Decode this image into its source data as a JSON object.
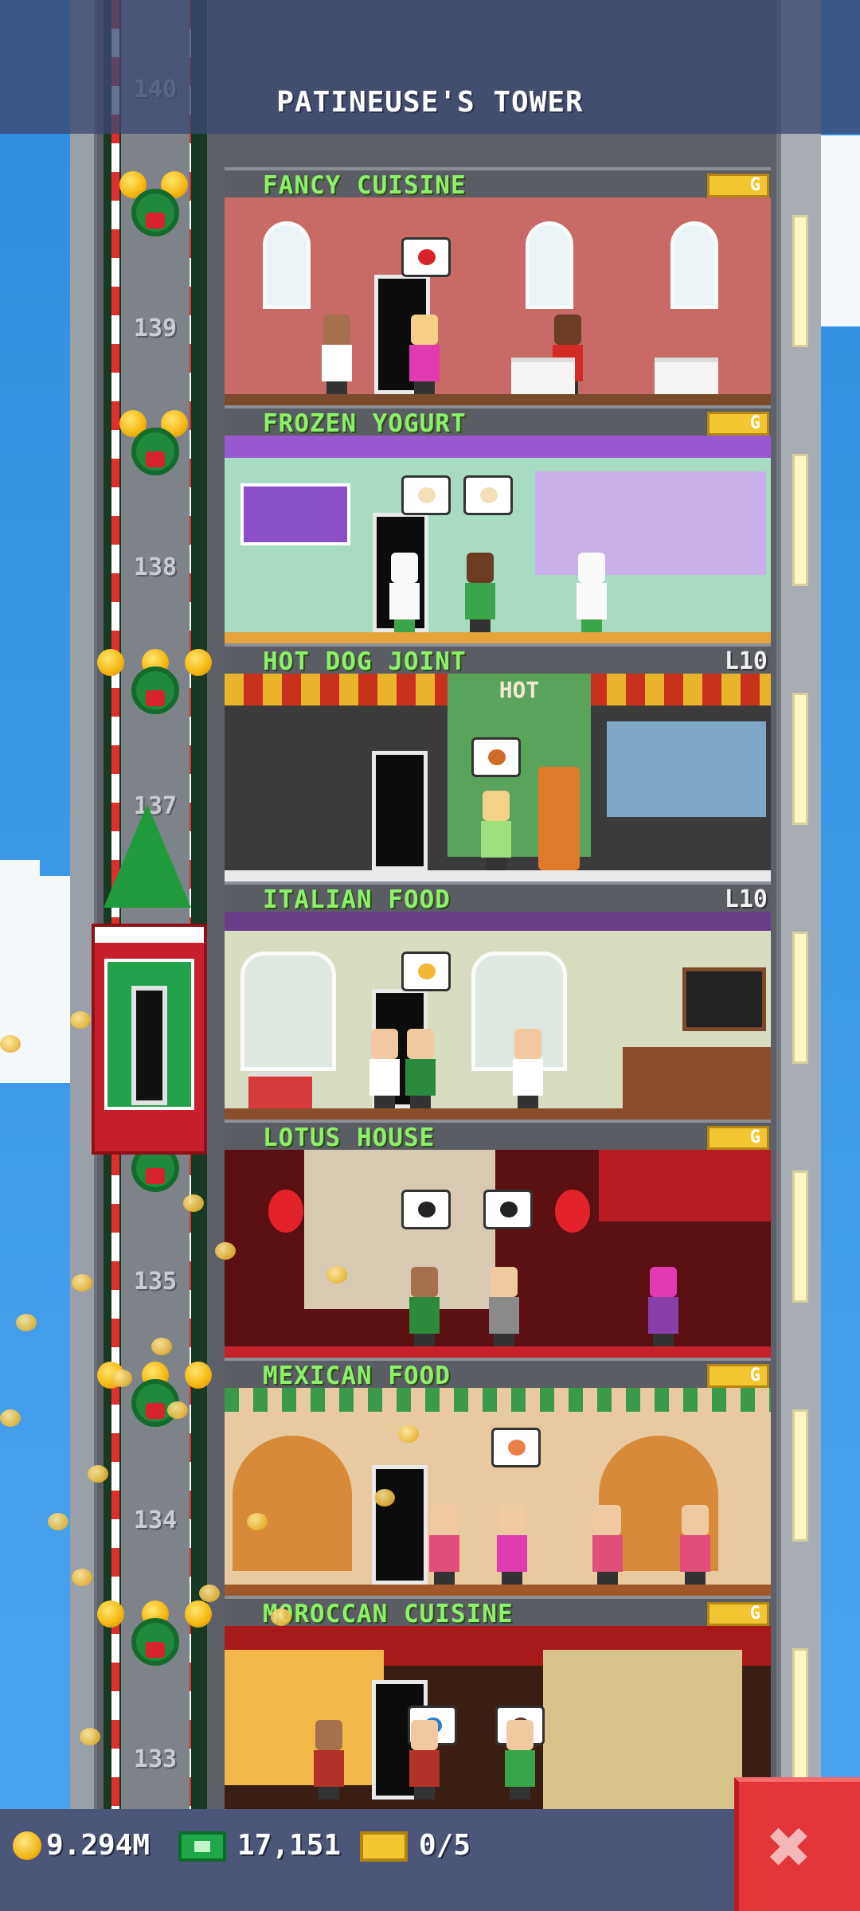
{
  "header": {
    "title": "PATINEUSE'S TOWER"
  },
  "floors": [
    {
      "name": "FANCY CUISINE",
      "badge": "G",
      "badge_type": "coin"
    },
    {
      "name": "FROZEN YOGURT",
      "badge": "G",
      "badge_type": "coin"
    },
    {
      "name": "HOT DOG JOINT",
      "badge": "L10",
      "badge_type": "level"
    },
    {
      "name": "ITALIAN FOOD",
      "badge": "L10",
      "badge_type": "level"
    },
    {
      "name": "LOTUS HOUSE",
      "badge": "G",
      "badge_type": "coin"
    },
    {
      "name": "MEXICAN FOOD",
      "badge": "G",
      "badge_type": "coin"
    },
    {
      "name": "MOROCCAN CUISINE",
      "badge": "G",
      "badge_type": "coin"
    }
  ],
  "floor_numbers": [
    "140",
    "139",
    "138",
    "137",
    "135",
    "134",
    "133"
  ],
  "signs": {
    "hot": "HOT"
  },
  "status": {
    "coins": "9.294M",
    "bux": "17,151",
    "tickets": "0/5"
  },
  "icons": {
    "coin": "coin-icon",
    "bux": "bux-icon",
    "ticket": "golden-ticket-icon",
    "close": "close-icon"
  },
  "colors": {
    "floor_label": "#8ef06a",
    "close_button": "#e33639",
    "bottom_bar": "#4c5678"
  }
}
